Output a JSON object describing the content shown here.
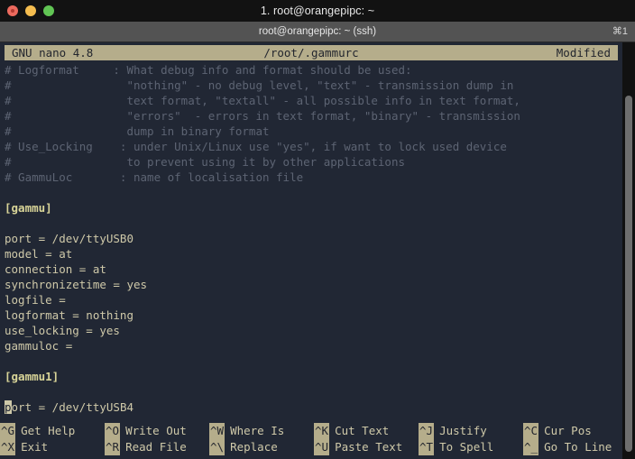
{
  "window": {
    "title": "1. root@orangepipc: ~",
    "traffic_lights": [
      "close",
      "minimize",
      "maximize"
    ]
  },
  "tabbar": {
    "title": "root@orangepipc: ~ (ssh)",
    "shortcut": "⌘1"
  },
  "nano": {
    "version_label": "GNU nano 4.8",
    "filename": "/root/.gammurc",
    "status": "Modified",
    "colors": {
      "bar_bg": "#b5ad8b",
      "bar_fg": "#23262e",
      "terminal_bg": "#212734",
      "comment_fg": "#5d6473",
      "text_fg": "#cfc9a9",
      "section_fg": "#d9d598"
    },
    "lines": [
      {
        "type": "comment",
        "text": "# Logformat     : What debug info and format should be used:"
      },
      {
        "type": "comment",
        "text": "#                 \"nothing\" - no debug level, \"text\" - transmission dump in"
      },
      {
        "type": "comment",
        "text": "#                 text format, \"textall\" - all possible info in text format,"
      },
      {
        "type": "comment",
        "text": "#                 \"errors\"  - errors in text format, \"binary\" - transmission"
      },
      {
        "type": "comment",
        "text": "#                 dump in binary format"
      },
      {
        "type": "comment",
        "text": "# Use_Locking    : under Unix/Linux use \"yes\", if want to lock used device"
      },
      {
        "type": "comment",
        "text": "#                 to prevent using it by other applications"
      },
      {
        "type": "comment",
        "text": "# GammuLoc       : name of localisation file"
      },
      {
        "type": "blank",
        "text": ""
      },
      {
        "type": "section",
        "text": "[gammu]"
      },
      {
        "type": "blank",
        "text": ""
      },
      {
        "type": "text",
        "text": "port = /dev/ttyUSB0"
      },
      {
        "type": "text",
        "text": "model = at"
      },
      {
        "type": "text",
        "text": "connection = at"
      },
      {
        "type": "text",
        "text": "synchronizetime = yes"
      },
      {
        "type": "text",
        "text": "logfile ="
      },
      {
        "type": "text",
        "text": "logformat = nothing"
      },
      {
        "type": "text",
        "text": "use_locking = yes"
      },
      {
        "type": "text",
        "text": "gammuloc ="
      },
      {
        "type": "blank",
        "text": ""
      },
      {
        "type": "section",
        "text": "[gammu1]"
      },
      {
        "type": "blank",
        "text": ""
      },
      {
        "type": "cursorline",
        "cursor_char": "p",
        "text": "ort = /dev/ttyUSB4"
      }
    ],
    "shortcuts_row1": [
      {
        "key": "^G",
        "label": "Get Help"
      },
      {
        "key": "^O",
        "label": "Write Out"
      },
      {
        "key": "^W",
        "label": "Where Is"
      },
      {
        "key": "^K",
        "label": "Cut Text"
      },
      {
        "key": "^J",
        "label": "Justify"
      },
      {
        "key": "^C",
        "label": "Cur Pos"
      }
    ],
    "shortcuts_row2": [
      {
        "key": "^X",
        "label": "Exit"
      },
      {
        "key": "^R",
        "label": "Read File"
      },
      {
        "key": "^\\",
        "label": "Replace"
      },
      {
        "key": "^U",
        "label": "Paste Text"
      },
      {
        "key": "^T",
        "label": "To Spell"
      },
      {
        "key": "^_",
        "label": "Go To Line"
      }
    ]
  }
}
